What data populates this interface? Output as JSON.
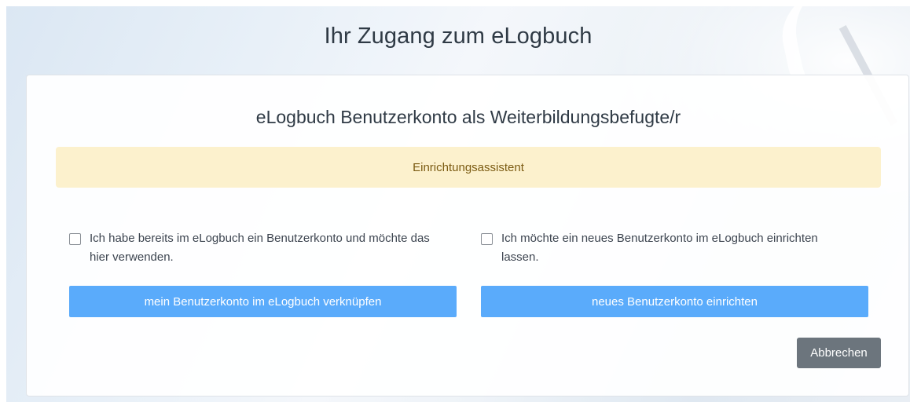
{
  "page": {
    "title": "Ihr Zugang zum eLogbuch"
  },
  "card": {
    "title": "eLogbuch Benutzerkonto als Weiterbildungsbefugte/r",
    "alert": "Einrichtungsassistent",
    "options": [
      {
        "label": "Ich habe bereits im eLogbuch ein Benutzerkonto und möchte das hier verwenden.",
        "checked": false,
        "button_label": "mein Benutzerkonto im eLogbuch verknüpfen"
      },
      {
        "label": "Ich möchte ein neues Benutzerkonto im eLogbuch einrichten lassen.",
        "checked": false,
        "button_label": "neues Benutzerkonto einrichten"
      }
    ],
    "cancel_label": "Abbrechen"
  },
  "colors": {
    "primary_button": "#5aabfb",
    "secondary_button": "#6c757d",
    "alert_background": "#fcf1cd",
    "alert_text": "#7b5b12"
  }
}
